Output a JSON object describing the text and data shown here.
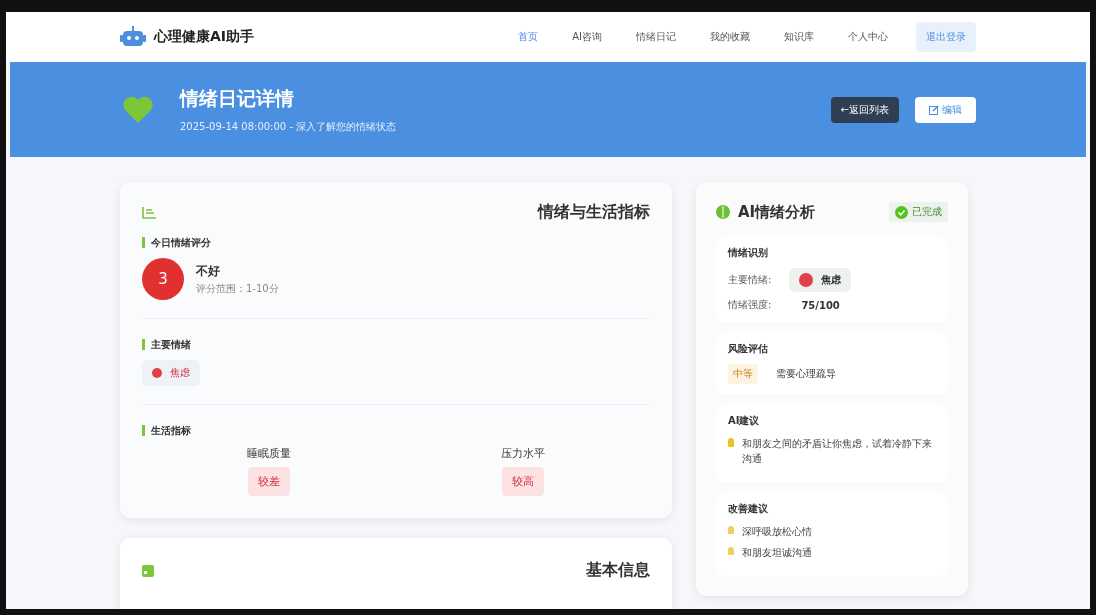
{
  "brand": "心理健康AI助手",
  "nav": [
    {
      "label": "首页",
      "selected": true
    },
    {
      "label": "AI咨询",
      "selected": false
    },
    {
      "label": "情绪日记",
      "selected": false
    },
    {
      "label": "我的收藏",
      "selected": false
    },
    {
      "label": "知识库",
      "selected": false
    },
    {
      "label": "个人中心",
      "selected": false
    }
  ],
  "logout": "退出登录",
  "header": {
    "title": "情绪日记详情",
    "subtitle": "2025-09-14 08:00:00 - 深入了解您的情绪状态",
    "back": "←返回列表",
    "edit": "编辑"
  },
  "metrics": {
    "title": "情绪与生活指标",
    "score_label": "今日情绪评分",
    "score": "3",
    "score_text": "不好",
    "score_range": "评分范围：1-10分",
    "emotion_label": "主要情绪",
    "emotion": "焦虑",
    "life_label": "生活指标",
    "life": [
      {
        "name": "睡眠质量",
        "value": "较差"
      },
      {
        "name": "压力水平",
        "value": "较高"
      }
    ]
  },
  "basic": {
    "title": "基本信息"
  },
  "analysis": {
    "title": "AI情绪分析",
    "status": "已完成",
    "recognition": {
      "title": "情绪识别",
      "main_label": "主要情绪:",
      "main": "焦虑",
      "intensity_label": "情绪强度:",
      "intensity": "75/100"
    },
    "risk": {
      "title": "风险评估",
      "level": "中等",
      "text": "需要心理疏导"
    },
    "advice": {
      "title": "AI建议",
      "text": "和朋友之间的矛盾让你焦虑，试着冷静下来沟通"
    },
    "improve": {
      "title": "改善建议",
      "items": [
        "深呼吸放松心情",
        "和朋友坦诚沟通"
      ]
    }
  }
}
